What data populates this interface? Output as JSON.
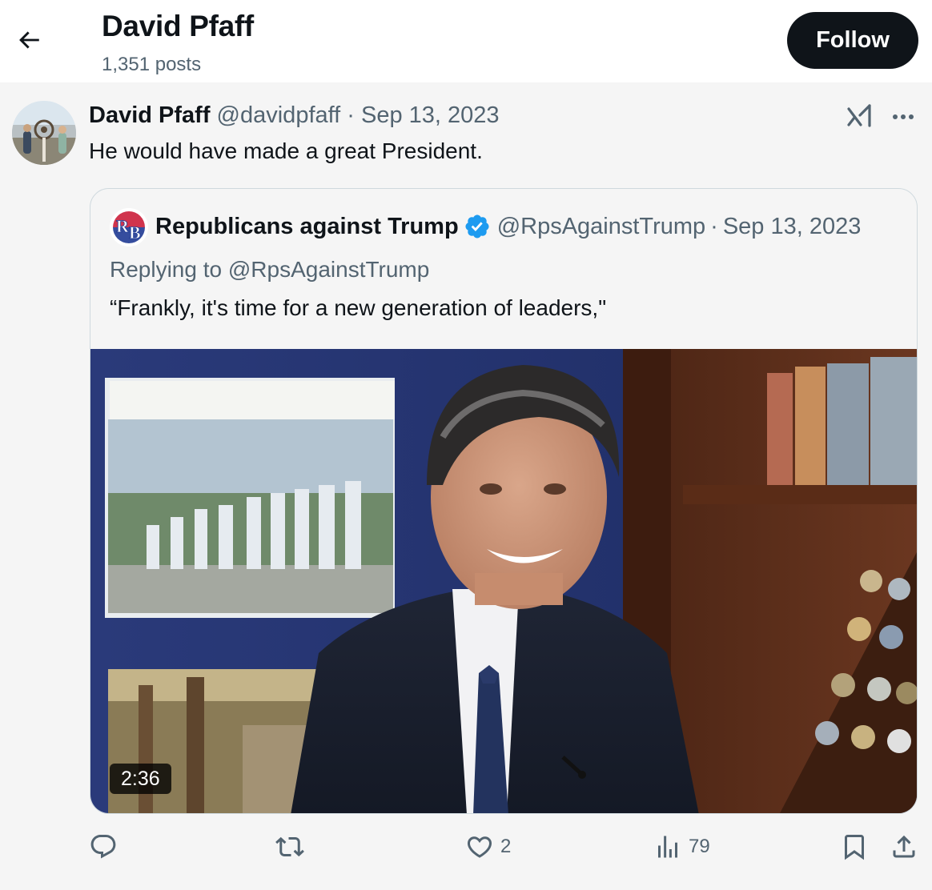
{
  "header": {
    "name": "David Pfaff",
    "posts_count": "1,351 posts",
    "follow_label": "Follow"
  },
  "tweet": {
    "author_name": "David Pfaff",
    "handle": "@davidpfaff",
    "separator": "·",
    "date": "Sep 13, 2023",
    "text": "He would have made a great President."
  },
  "quote": {
    "avatar_text": "RB",
    "author_name": "Republicans against Trump",
    "handle": "@RpsAgainstTrump",
    "separator": "·",
    "date": "Sep 13, 2023",
    "replying_to": "Replying to @RpsAgainstTrump",
    "text": "“Frankly, it's time for a new generation of leaders,\"",
    "video_duration": "2:36"
  },
  "actions": {
    "reply_count": "",
    "repost_count": "",
    "like_count": "2",
    "views_count": "79"
  },
  "icons": {
    "back": "back-arrow-icon",
    "grok": "grok-icon",
    "more": "more-icon",
    "verified": "verified-badge-icon",
    "reply": "reply-icon",
    "repost": "repost-icon",
    "like": "like-icon",
    "views": "views-icon",
    "bookmark": "bookmark-icon",
    "share": "share-icon"
  },
  "colors": {
    "follow_bg": "#0f1419",
    "muted_text": "#536471",
    "verified_blue": "#1d9bf0",
    "background": "#f5f5f5"
  }
}
